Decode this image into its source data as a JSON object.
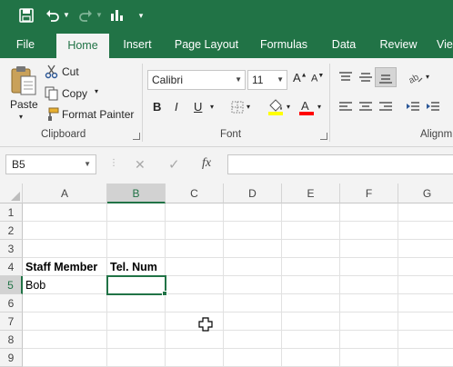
{
  "quick_access": {
    "save_icon": "save-icon",
    "undo_icon": "undo-icon",
    "redo_icon": "redo-icon",
    "chart_icon": "chart-icon",
    "customize_icon": "customize-qat-icon"
  },
  "ribbon_tabs": [
    "File",
    "Home",
    "Insert",
    "Page Layout",
    "Formulas",
    "Data",
    "Review",
    "Vie"
  ],
  "active_tab": "Home",
  "clipboard": {
    "paste_label": "Paste",
    "cut_label": "Cut",
    "copy_label": "Copy",
    "format_painter_label": "Format Painter",
    "group_label": "Clipboard"
  },
  "font": {
    "family": "Calibri",
    "size": "11",
    "bold": "B",
    "italic": "I",
    "underline": "U",
    "group_label": "Font"
  },
  "alignment": {
    "group_label": "Alignm"
  },
  "formula_bar": {
    "name_box": "B5",
    "cancel": "✕",
    "enter": "✓",
    "fx": "fx",
    "value": ""
  },
  "columns": [
    "A",
    "B",
    "C",
    "D",
    "E",
    "F",
    "G"
  ],
  "selected_column": "B",
  "rows": [
    "1",
    "2",
    "3",
    "4",
    "5",
    "6",
    "7",
    "8",
    "9"
  ],
  "selected_row": "5",
  "cells": {
    "A4": "Staff Member",
    "B4": "Tel. Num",
    "A5": "Bob"
  },
  "colors": {
    "accent": "#217346",
    "font_highlight": "#ffff00",
    "font_color": "#ff0000"
  }
}
